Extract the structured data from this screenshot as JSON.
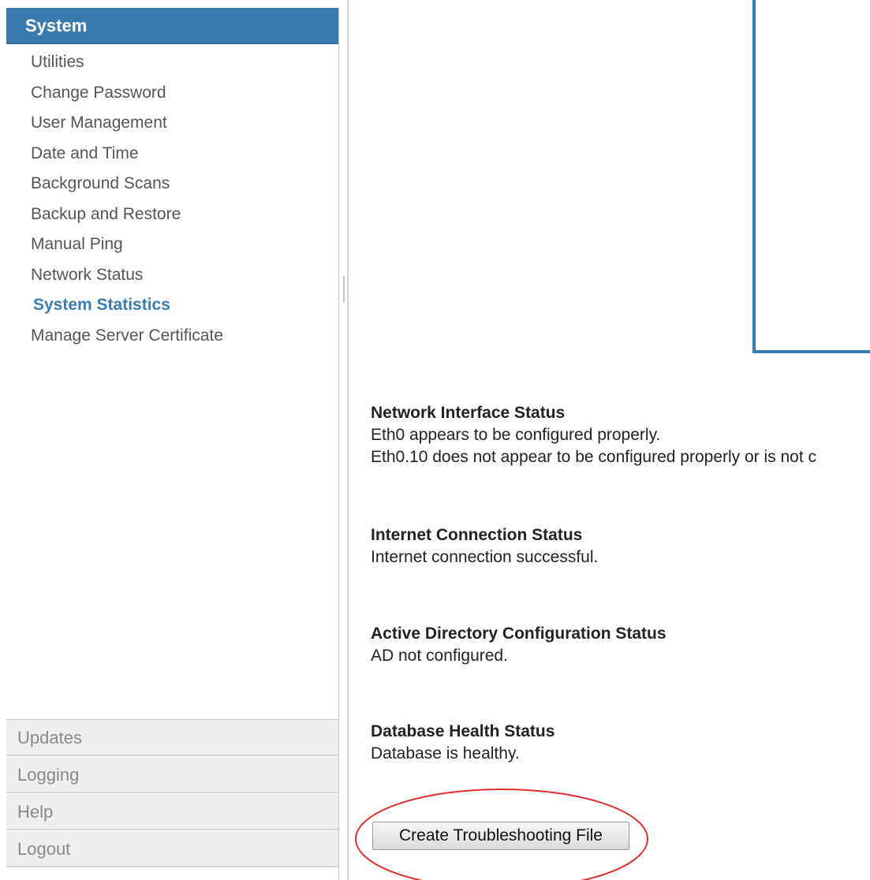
{
  "sidebar": {
    "header": "System",
    "items": [
      {
        "label": "Utilities"
      },
      {
        "label": "Change Password"
      },
      {
        "label": "User Management"
      },
      {
        "label": "Date and Time"
      },
      {
        "label": "Background Scans"
      },
      {
        "label": "Backup and Restore"
      },
      {
        "label": "Manual Ping"
      },
      {
        "label": "Network Status"
      },
      {
        "label": "System Statistics",
        "active": true
      },
      {
        "label": "Manage Server Certificate"
      }
    ],
    "bottom": [
      {
        "label": "Updates"
      },
      {
        "label": "Logging"
      },
      {
        "label": "Help"
      },
      {
        "label": "Logout"
      }
    ]
  },
  "main": {
    "network": {
      "title": "Network Interface Status",
      "line1": "Eth0 appears to be configured properly.",
      "line2": "Eth0.10 does not appear to be configured properly or is not c"
    },
    "internet": {
      "title": "Internet Connection Status",
      "line1": "Internet connection successful."
    },
    "ad": {
      "title": "Active Directory Configuration Status",
      "line1": "AD not configured."
    },
    "database": {
      "title": "Database Health Status",
      "line1": "Database is healthy."
    },
    "troubleshoot_button": "Create Troubleshooting File"
  },
  "colors": {
    "accent": "#3a7bb0",
    "highlight": "#e03030"
  }
}
